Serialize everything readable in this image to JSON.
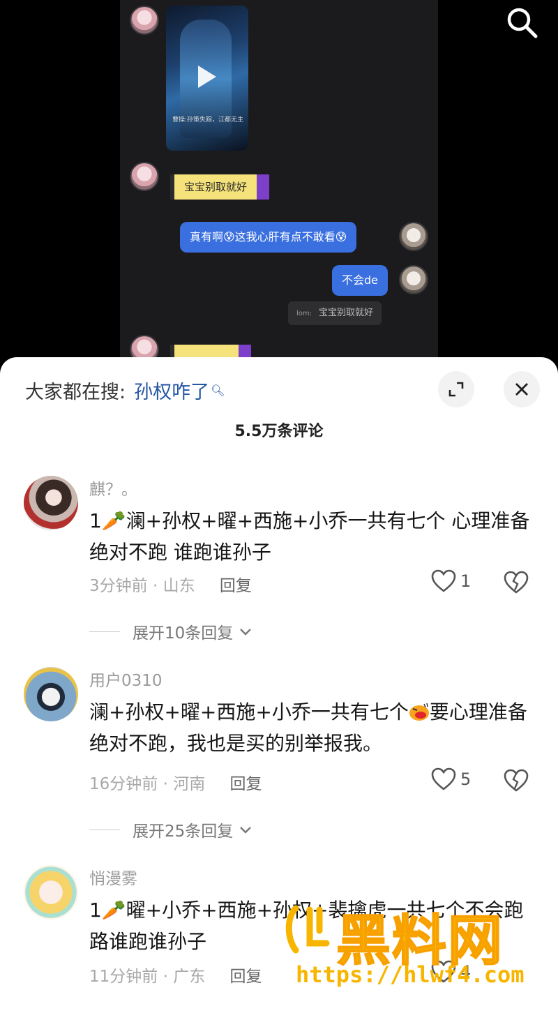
{
  "video": {
    "caption": "曹操:孙策失踪，江都无主",
    "chat": {
      "left_bubble_1": "宝宝别取就好",
      "right_bubble_1": "真有啊😰这我心肝有点不敢看😰",
      "right_bubble_2": "不会de",
      "quote_tag": "lom:",
      "quote_text": "宝宝别取就好"
    }
  },
  "panel": {
    "search_prefix": "大家都在搜:",
    "search_term": "孙权咋了",
    "comment_count": "5.5万条评论",
    "comments": [
      {
        "name": "麒？。",
        "text": "1🥕澜+孙权+曜+西施+小乔一共有七个 心理准备绝对不跑 谁跑谁孙子",
        "time": "3分钟前",
        "location": "山东",
        "reply": "回复",
        "likes": "1",
        "expand": "展开10条回复"
      },
      {
        "name": "用户0310",
        "text_a": "澜+孙权+曜+西施+小乔一共有七个",
        "text_b": "要心理准备绝对不跑，我也是买的别举报我。",
        "time": "16分钟前",
        "location": "河南",
        "reply": "回复",
        "likes": "5",
        "expand": "展开25条回复"
      },
      {
        "name": "悄漫雾",
        "text": "1🥕曜+小乔+西施+孙权+裴擒虎一共七个不会跑路谁跑谁孙子",
        "time": "11分钟前",
        "location": "广东",
        "reply": "回复",
        "likes": "4"
      }
    ]
  },
  "watermark": {
    "title": "黑料网",
    "url": "https://hlwf4.com"
  },
  "icons": [
    "search-icon",
    "play-icon",
    "expand-icon",
    "close-icon",
    "heart-icon",
    "broken-heart-icon",
    "chevron-down-icon"
  ]
}
